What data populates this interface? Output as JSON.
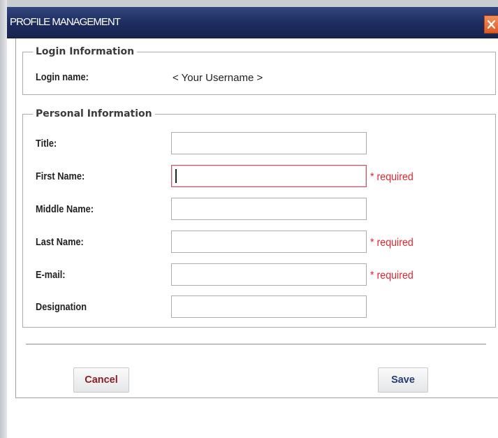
{
  "window": {
    "title": "PROFILE MANAGEMENT",
    "close_icon": "close-x-icon"
  },
  "login_section": {
    "legend": "Login Information",
    "login_name_label": "Login name:",
    "login_name_value": "< Your Username >"
  },
  "personal_section": {
    "legend": "Personal Information",
    "fields": [
      {
        "label": "Title:",
        "value": "",
        "required_text": ""
      },
      {
        "label": "First Name:",
        "value": "",
        "required_text": "* required"
      },
      {
        "label": "Middle Name:",
        "value": "",
        "required_text": ""
      },
      {
        "label": "Last Name:",
        "value": "",
        "required_text": "* required"
      },
      {
        "label": "E-mail:",
        "value": "",
        "required_text": "* required"
      },
      {
        "label": "Designation",
        "value": "",
        "required_text": ""
      }
    ]
  },
  "actions": {
    "cancel_label": "Cancel",
    "save_label": "Save"
  },
  "colors": {
    "titlebar": "#1c2c5e",
    "required": "#e0262f",
    "cancel_text": "#8b1e24",
    "save_text": "#243e73",
    "close_button": "#e05a23"
  }
}
